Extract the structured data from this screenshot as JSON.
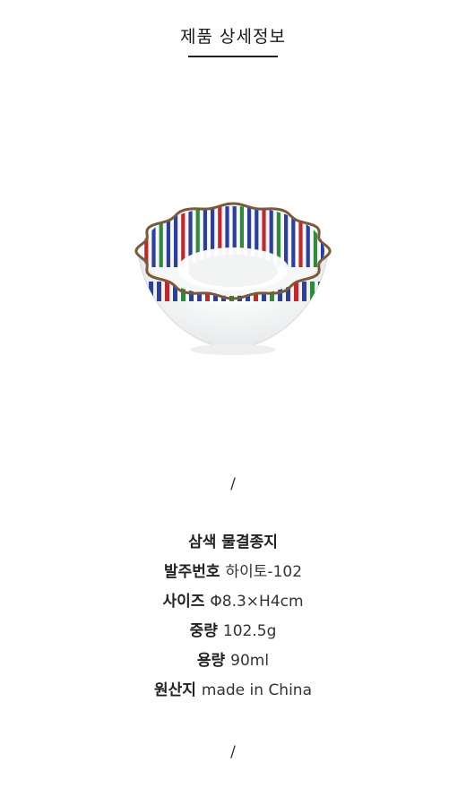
{
  "header": {
    "title": "제품 상세정보"
  },
  "image": {
    "subject": "bowl",
    "stripe_colors": [
      "#2d3f9e",
      "#c2282b",
      "#2f8a3e"
    ],
    "rim_color": "#7a5a3a"
  },
  "divider": "/",
  "product": {
    "name": "삼색 물결종지",
    "specs": [
      {
        "label": "발주번호",
        "value": "하이토-102"
      },
      {
        "label": "사이즈",
        "value": "Φ8.3×H4cm"
      },
      {
        "label": "중량",
        "value": "102.5g"
      },
      {
        "label": "용량",
        "value": "90ml"
      },
      {
        "label": "원산지",
        "value": "made in China"
      }
    ]
  }
}
